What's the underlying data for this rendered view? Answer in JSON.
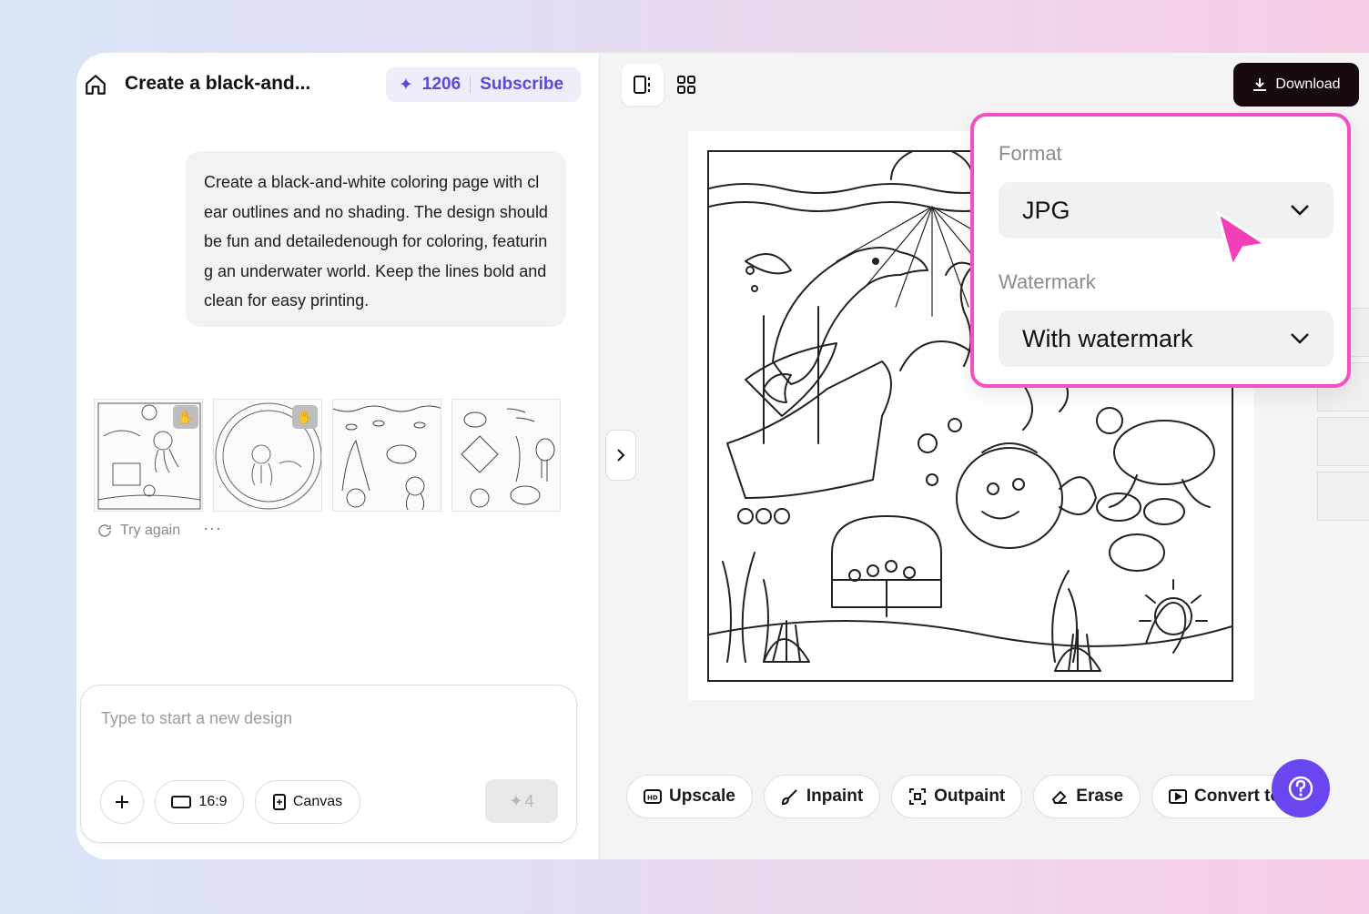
{
  "header": {
    "title": "Create a black-and...",
    "credits": "1206",
    "subscribe_label": "Subscribe"
  },
  "prompt": {
    "text": "Create a black-and-white coloring page with clear outlines and no shading. The design should be fun and detailedenough for coloring, featuring an underwater world. Keep the lines bold and clean for easy printing."
  },
  "results": {
    "try_again_label": "Try again",
    "more_label": "···"
  },
  "composer": {
    "placeholder": "Type to start a new design",
    "ratio_label": "16:9",
    "canvas_label": "Canvas",
    "cost": "4"
  },
  "toolbar": {
    "download_label": "Download",
    "tools": [
      {
        "label": "Upscale",
        "icon": "hd-icon"
      },
      {
        "label": "Inpaint",
        "icon": "brush-icon"
      },
      {
        "label": "Outpaint",
        "icon": "expand-icon"
      },
      {
        "label": "Erase",
        "icon": "eraser-icon"
      },
      {
        "label": "Convert to v",
        "icon": "video-icon"
      }
    ]
  },
  "download_popover": {
    "format_label": "Format",
    "format_value": "JPG",
    "watermark_label": "Watermark",
    "watermark_value": "With watermark"
  },
  "colors": {
    "accent": "#5b46e0",
    "highlight": "#f450c4",
    "help_button": "#6a46f0",
    "download_bg": "#16090f"
  }
}
